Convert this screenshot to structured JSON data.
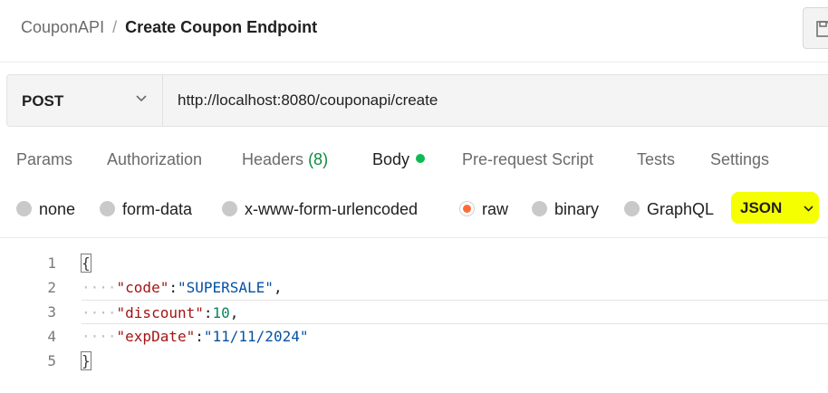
{
  "breadcrumb": {
    "parent": "CouponAPI",
    "separator": "/",
    "current": "Create Coupon Endpoint"
  },
  "request": {
    "method": "POST",
    "url": "http://localhost:8080/couponapi/create"
  },
  "tabs": [
    {
      "label": "Params"
    },
    {
      "label": "Authorization"
    },
    {
      "label": "Headers",
      "count": "(8)"
    },
    {
      "label": "Body",
      "active": true
    },
    {
      "label": "Pre-request Script"
    },
    {
      "label": "Tests"
    },
    {
      "label": "Settings"
    }
  ],
  "body_types": [
    {
      "label": "none"
    },
    {
      "label": "form-data"
    },
    {
      "label": "x-www-form-urlencoded"
    },
    {
      "label": "raw",
      "selected": true
    },
    {
      "label": "binary"
    },
    {
      "label": "GraphQL"
    }
  ],
  "format": {
    "selected": "JSON",
    "highlight_color": "#f6ff00"
  },
  "editor": {
    "line_numbers": [
      "1",
      "2",
      "3",
      "4",
      "5"
    ],
    "open_brace": "{",
    "close_brace": "}",
    "indent": "····",
    "fields": [
      {
        "key": "\"code\"",
        "colon": ":",
        "value": "\"SUPERSALE\"",
        "comma": ","
      },
      {
        "key": "\"discount\"",
        "colon": ":",
        "value": "10",
        "comma": ","
      },
      {
        "key": "\"expDate\"",
        "colon": ":",
        "value": "\"11/11/2024\"",
        "comma": ""
      }
    ]
  },
  "colors": {
    "accent_orange": "#ff6c37",
    "status_green": "#0cbb52"
  },
  "icons": {
    "save": "save-icon",
    "chevron": "chevron-down-icon"
  }
}
